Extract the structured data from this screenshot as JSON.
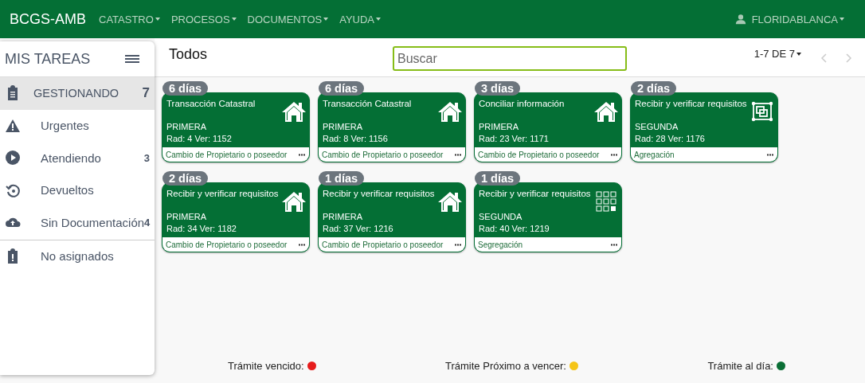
{
  "navbar": {
    "brand": "BCGS-AMB",
    "menus": [
      "CATASTRO",
      "PROCESOS",
      "DOCUMENTOS",
      "AYUDA"
    ],
    "user": "FLORIDABLANCA"
  },
  "sidebar": {
    "title": "MIS TAREAS",
    "sections": [
      {
        "items": [
          {
            "kind": "clipboard",
            "label": "GESTIONANDO",
            "count": "7",
            "selected": true
          },
          {
            "kind": "warning",
            "label": "Urgentes",
            "selected": false
          },
          {
            "kind": "play",
            "label": "Atendiendo",
            "count": "3",
            "selected": false
          },
          {
            "kind": "undo",
            "label": "Devueltos",
            "selected": false
          },
          {
            "kind": "upload",
            "label": "Sin Documentación",
            "count": "4",
            "selected": false
          }
        ]
      },
      {
        "items": [
          {
            "kind": "alert-clipboard",
            "label": "No asignados",
            "selected": false
          }
        ]
      }
    ]
  },
  "header": {
    "title": "Todos",
    "search": {
      "placeholder": "Buscar"
    },
    "pagination": "1-7 DE 7"
  },
  "cards": [
    {
      "days": "6 días",
      "task": "Transacción Catastral",
      "kind": "house",
      "instance": "PRIMERA",
      "rad": "Rad: 4 Ver: 1152",
      "process": "Cambio de Propietario o poseedor"
    },
    {
      "days": "6 días",
      "task": "Transacción Catastral",
      "kind": "house",
      "instance": "PRIMERA",
      "rad": "Rad: 8 Ver: 1156",
      "process": "Cambio de Propietario o poseedor"
    },
    {
      "days": "3 días",
      "task": "Conciliar información",
      "kind": "house",
      "instance": "PRIMERA",
      "rad": "Rad: 23 Ver: 1171",
      "process": "Cambio de Propietario o poseedor"
    },
    {
      "days": "2 días",
      "task": "Recibir y verificar requisitos",
      "kind": "merge",
      "instance": "SEGUNDA",
      "rad": "Rad: 28 Ver: 1176",
      "process": "Agregación"
    },
    {
      "days": "2 días",
      "task": "Recibir y verificar requisitos",
      "kind": "house",
      "instance": "PRIMERA",
      "rad": "Rad: 34 Ver: 1182",
      "process": "Cambio de Propietario o poseedor"
    },
    {
      "days": "1 días",
      "task": "Recibir y verificar requisitos",
      "kind": "house",
      "instance": "PRIMERA",
      "rad": "Rad: 37 Ver: 1216",
      "process": "Cambio de Propietario o poseedor"
    },
    {
      "days": "1 días",
      "task": "Recibir y verificar requisitos",
      "kind": "grid",
      "instance": "SEGUNDA",
      "rad": "Rad: 40 Ver: 1219",
      "process": "Segregación"
    }
  ],
  "legend": [
    {
      "label": "Trámite vencido:",
      "color": "#e61c1c"
    },
    {
      "label": "Trámite Próximo a vencer:",
      "color": "#f5c518"
    },
    {
      "label": "Trámite al día:",
      "color": "#0a6e35"
    }
  ]
}
